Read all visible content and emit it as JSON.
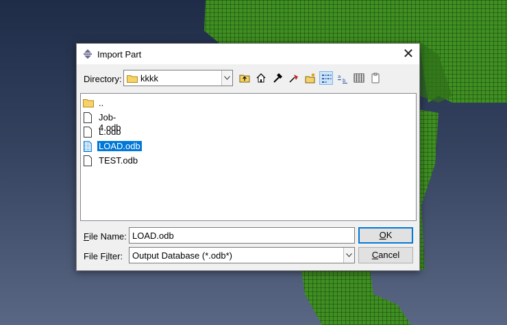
{
  "dialog": {
    "title": "Import Part",
    "close_glyph": "✕"
  },
  "directory": {
    "label": "Directory:",
    "value": "kkkk"
  },
  "toolbar": {
    "icons": [
      "up-folder-icon",
      "home-icon",
      "hammer-icon",
      "bookmark-icon",
      "new-folder-icon",
      "list-view-icon",
      "details-view-icon",
      "grid-view-icon",
      "clipboard-icon"
    ],
    "active": "list-view-icon"
  },
  "files": [
    {
      "name": "..",
      "type": "folder"
    },
    {
      "name": "Job-4.odb",
      "type": "file"
    },
    {
      "name": "L.odb",
      "type": "file"
    },
    {
      "name": "LOAD.odb",
      "type": "file",
      "selected": true
    },
    {
      "name": "TEST.odb",
      "type": "file"
    }
  ],
  "file_name": {
    "label_first": "F",
    "label_rest": "ile Name:",
    "value": "LOAD.odb"
  },
  "file_filter": {
    "label_pre": "File F",
    "label_u": "i",
    "label_post": "lter:",
    "value": "Output Database (*.odb*)"
  },
  "buttons": {
    "ok_u": "O",
    "ok_rest": "K",
    "cancel_u": "C",
    "cancel_rest": "ancel"
  },
  "colors": {
    "mesh_green": "#3f8f22",
    "selection_blue": "#0078d7",
    "background_navy": "#263454"
  }
}
